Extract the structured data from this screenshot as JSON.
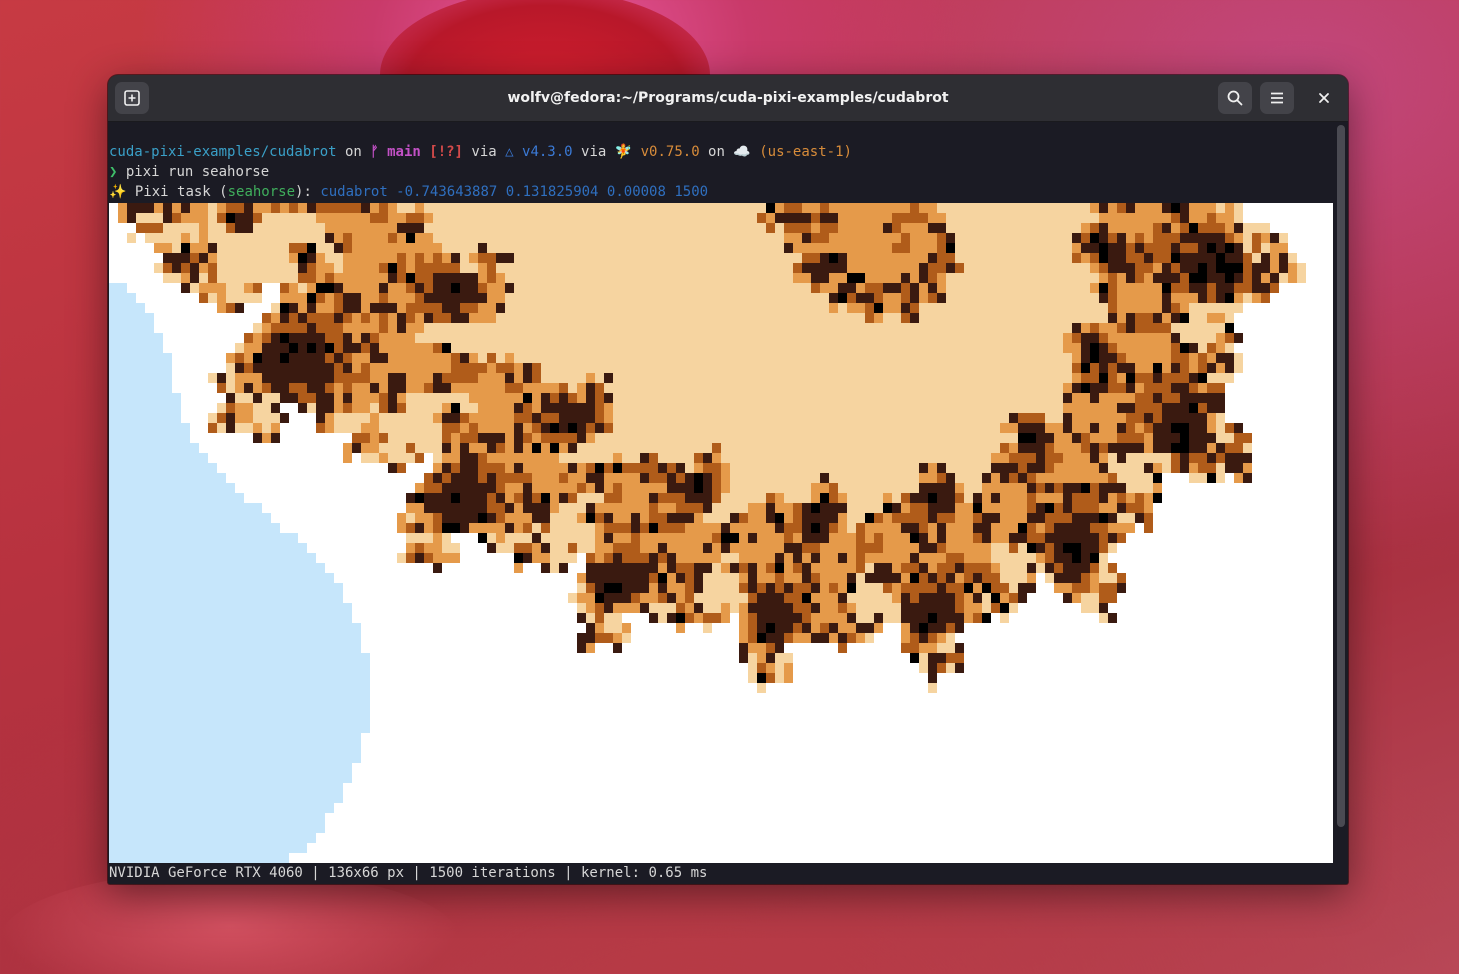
{
  "window": {
    "title": "wolfv@fedora:~/Programs/cuda-pixi-examples/cudabrot",
    "new_tab_icon": "new-tab-icon",
    "search_icon": "search-icon",
    "menu_icon": "hamburger-menu-icon",
    "close_icon": "close-icon"
  },
  "terminal": {
    "prompt_line": {
      "path": "cuda-pixi-examples/cudabrot",
      "on1": " on ",
      "git_symbol": "ᚠ main",
      "git_status": " [!?]",
      "via1": " via ",
      "cmake_symbol": "△ v4.3.0",
      "via2": " via ",
      "pixi_symbol": "🧚",
      "pixi_version": " v0.75.0",
      "on2": " on ",
      "cloud_symbol": "☁️",
      "region": " (us-east-1)"
    },
    "command_line": {
      "prompt": "❯",
      "command": " pixi run seahorse"
    },
    "task_line": {
      "sparkle": "✨",
      "label": " Pixi task (",
      "task_name": "seahorse",
      "label_end": "): ",
      "task_cmd": "cudabrot -0.743643887 0.131825904 0.00008 1500"
    },
    "status_line": "NVIDIA GeForce RTX 4060 | 136x66 px | 1500 iterations | kernel: 0.65 ms"
  },
  "fractal": {
    "grid_cols": 136,
    "grid_rows": 66,
    "palette": [
      "#0b3a86",
      "#1e5fad",
      "#3d86c8",
      "#7db8e6",
      "#c6e6fb",
      "#ffffff",
      "#f6d4a0",
      "#e59a4a",
      "#b05c1a",
      "#3a1a10"
    ],
    "interior_color": "#000000"
  },
  "colors": {
    "window_bg": "#1b1b24",
    "titlebar_bg": "#2e2e33",
    "path": "#3aa0c8",
    "git": "#c251c5",
    "git_status": "#d34a4a",
    "cmake": "#3b7ad6",
    "pixi": "#d88c3a",
    "task_name": "#3fae5c",
    "task_cmd": "#2f6fbf"
  }
}
